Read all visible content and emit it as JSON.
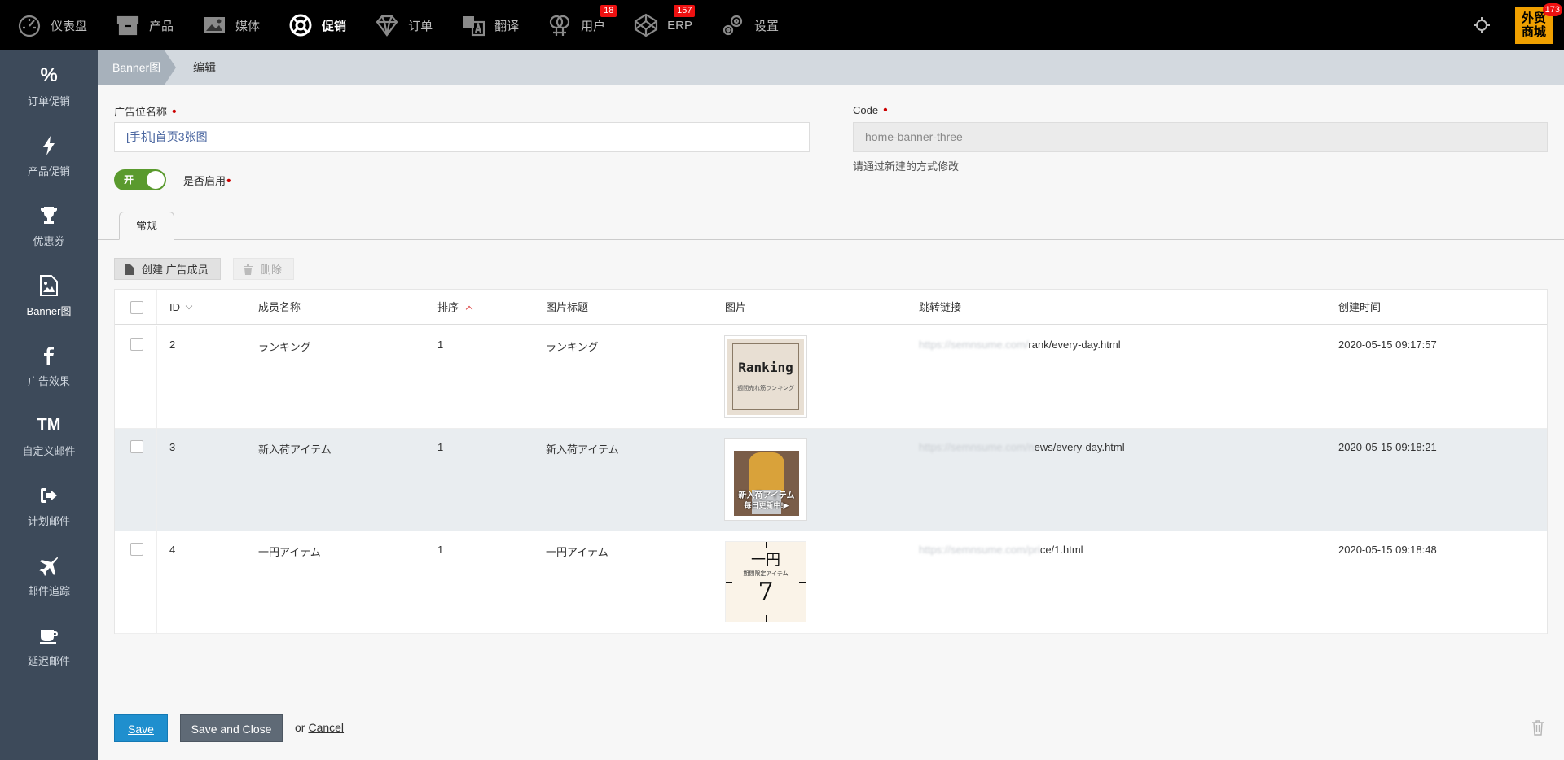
{
  "topnav": [
    {
      "label": "仪表盘",
      "icon": "dashboard-icon",
      "badge": ""
    },
    {
      "label": "产品",
      "icon": "archive-box-icon",
      "badge": ""
    },
    {
      "label": "媒体",
      "icon": "image-icon",
      "badge": ""
    },
    {
      "label": "促销",
      "icon": "lifebuoy-icon",
      "badge": "",
      "active": true
    },
    {
      "label": "订单",
      "icon": "diamond-icon",
      "badge": ""
    },
    {
      "label": "翻译",
      "icon": "translate-icon",
      "badge": ""
    },
    {
      "label": "用户",
      "icon": "gender-icon",
      "badge": "18"
    },
    {
      "label": "ERP",
      "icon": "codepen-icon",
      "badge": "157"
    },
    {
      "label": "设置",
      "icon": "gears-icon",
      "badge": ""
    }
  ],
  "store": {
    "label_line1": "外贸",
    "label_line2": "商城",
    "badge": "173"
  },
  "sidebar": [
    {
      "label": "订单促销",
      "icon": "percent-icon"
    },
    {
      "label": "产品促销",
      "icon": "bolt-icon"
    },
    {
      "label": "优惠券",
      "icon": "trophy-icon"
    },
    {
      "label": "Banner图",
      "icon": "picture-icon",
      "active": true
    },
    {
      "label": "广告效果",
      "icon": "facebook-icon"
    },
    {
      "label": "自定义邮件",
      "icon": "tm-icon",
      "glyph": "TM"
    },
    {
      "label": "计划邮件",
      "icon": "sign-out-icon"
    },
    {
      "label": "邮件追踪",
      "icon": "plane-icon"
    },
    {
      "label": "延迟邮件",
      "icon": "coffee-icon"
    }
  ],
  "breadcrumb": {
    "first": "Banner图",
    "second": "编辑"
  },
  "form": {
    "name_label": "广告位名称",
    "name_value": "[手机]首页3张图",
    "code_label": "Code",
    "code_value": "home-banner-three",
    "code_hint": "请通过新建的方式修改",
    "enabled_label": "是否启用",
    "enabled_state": "开",
    "required_mark": "•"
  },
  "tabs": [
    {
      "label": "常规",
      "active": true
    }
  ],
  "toolbar": {
    "create_label": "创建 广告成员",
    "delete_label": "删除"
  },
  "grid": {
    "columns": {
      "id": "ID",
      "name": "成员名称",
      "sort": "排序",
      "title": "图片标题",
      "image": "图片",
      "link": "跳转链接",
      "created": "创建时间"
    },
    "rows": [
      {
        "id": "2",
        "name": "ランキング",
        "sort": "1",
        "title": "ランキング",
        "link_hidden": "https://semnsume.com/",
        "link_visible": "rank/every-day.html",
        "created": "2020-05-15 09:17:57",
        "thumb_title": "Ranking",
        "thumb_sub": "週間売れ筋ランキング"
      },
      {
        "id": "3",
        "name": "新入荷アイテム",
        "sort": "1",
        "title": "新入荷アイテム",
        "link_hidden": "https://semnsume.com/n",
        "link_visible": "ews/every-day.html",
        "created": "2020-05-15 09:18:21",
        "thumb_title": "新入荷アイテム",
        "thumb_sub": "毎日更新中!▶"
      },
      {
        "id": "4",
        "name": "一円アイテム",
        "sort": "1",
        "title": "一円アイテム",
        "link_hidden": "https://semnsume.com/pri",
        "link_visible": "ce/1.html",
        "created": "2020-05-15 09:18:48",
        "thumb_title": "一円",
        "thumb_sub": "期間限定アイテム",
        "thumb_big": "7"
      }
    ]
  },
  "footer": {
    "save_label": "Save",
    "save_close_label": "Save and Close",
    "or_text": "or",
    "cancel_label": "Cancel"
  },
  "colors": {
    "topbar": "#000000",
    "sidebar": "#3d4a5a",
    "accent": "#1f8fce",
    "toggle_on": "#5a9a2e",
    "badge": "#ee1111",
    "store": "#f0a000"
  }
}
